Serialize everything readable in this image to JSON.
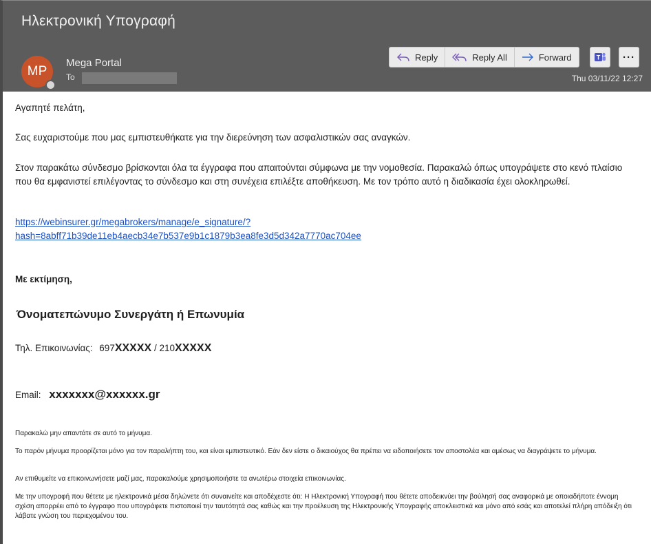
{
  "email": {
    "subject": "Ηλεκτρονική Υπογραφή",
    "sender_initials": "MP",
    "sender_name": "Mega Portal",
    "to_label": "To",
    "date": "Thu 03/11/22 12:27"
  },
  "toolbar": {
    "reply": "Reply",
    "reply_all": "Reply All",
    "forward": "Forward",
    "more": "···"
  },
  "body": {
    "greeting": "Αγαπητέ πελάτη,",
    "thanks": "Σας ευχαριστούμε που μας εμπιστευθήκατε για την διερεύνηση των ασφαλιστικών σας αναγκών.",
    "instructions": "Στον παρακάτω σύνδεσμο βρίσκονται όλα τα έγγραφα που απαιτούνται σύμφωνα με την νομοθεσία. Παρακαλώ όπως υπογράψετε στο κενό πλαίσιο που θα εμφανιστεί επιλέγοντας το σύνδεσμο και στη συνέχεια επιλέξτε αποθήκευση. Με τον τρόπο αυτό η διαδικασία έχει ολοκληρωθεί.",
    "link_line1": "https://webinsurer.gr/megabrokers/manage/e_signature/?",
    "link_line2": "hash=8abff71b39de11eb4aecb34e7b537e9b1c1879b3ea8fe3d5d342a7770ac704ee",
    "regards": "Με εκτίμηση,",
    "signature_name": "Όνοματεπώνυμο Συνεργάτη ή Επωνυμία",
    "phone_label": "Τηλ. Επικοινωνίας:",
    "phone_mobile_prefix": "697",
    "phone_mobile_mask": "XXXXX",
    "phone_sep": "/",
    "phone_land_prefix": "210",
    "phone_land_mask": "XXXXX",
    "email_label": "Email:",
    "email_value": "xxxxxxx@xxxxxx.gr",
    "disclaimer_1": "Παρακαλώ μην απαντάτε σε αυτό το μήνυμα.",
    "disclaimer_2": "Το παρόν μήνυμα προορίζεται μόνο για τον παραλήπτη του, και είναι εμπιστευτικό. Εάν δεν είστε ο δικαιούχος θα πρέπει να ειδοποιήσετε τον αποστολέα και αμέσως να διαγράψετε το μήνυμα.",
    "disclaimer_3": "Αν επιθυμείτε να επικοινωνήσετε μαζί μας, παρακαλούμε χρησιμοποιήστε τα ανωτέρω στοιχεία επικοινωνίας.",
    "disclaimer_4": "Με την υπογραφή που θέτετε με ηλεκτρονικά μέσα δηλώνετε ότι συναινείτε και αποδέχεστε ότι: Η Ηλεκτρονική Υπογραφή που θέτετε αποδεικνύει την βούλησή σας αναφορικά με οποιαδήποτε έννομη σχέση απορρέει από το έγγραφο που υπογράφετε πιστοποιεί την ταυτότητά σας καθώς και την προέλευση της Ηλεκτρονικής Υπογραφής αποκλειστικά και μόνο από εσάς και αποτελεί πλήρη απόδειξη ότι λάβατε γνώση του περιεχομένου του."
  },
  "colors": {
    "header_bg": "#5c5c5c",
    "avatar_bg": "#c8522a",
    "link": "#1a4fc4",
    "teams": "#4b53bc"
  }
}
